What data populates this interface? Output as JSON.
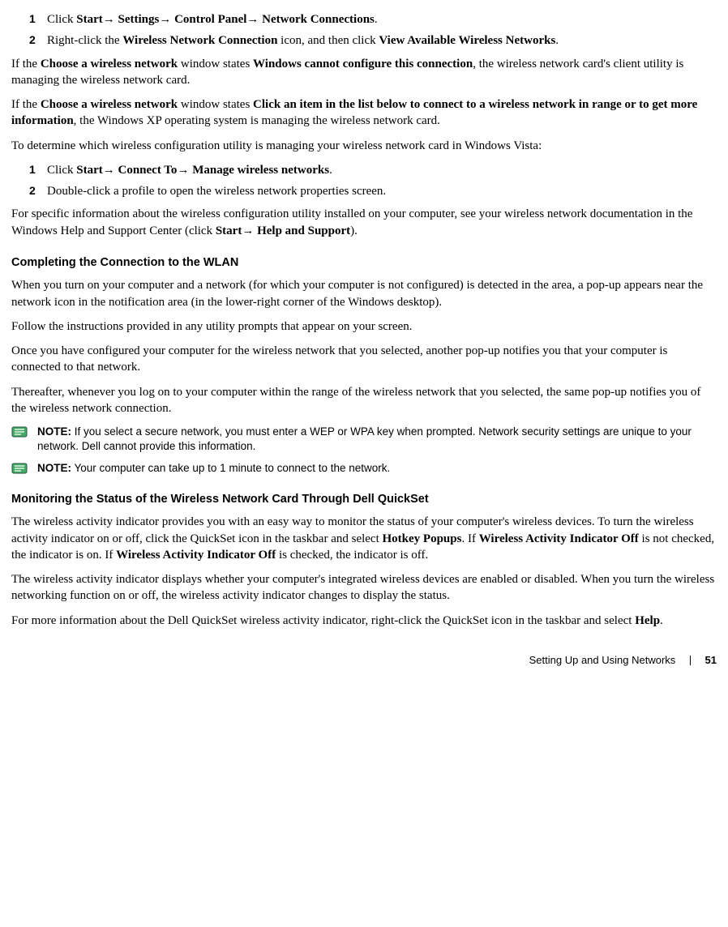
{
  "listA": {
    "step1": {
      "num": "1",
      "pre": "Click ",
      "b1": "Start",
      "arr1": "→ ",
      "b2": "Settings",
      "arr2": "→ ",
      "b3": "Control Panel",
      "arr3": "→ ",
      "b4": "Network Connections",
      "post": "."
    },
    "step2": {
      "num": "2",
      "pre": "Right-click the ",
      "b1": "Wireless Network Connection",
      "mid": " icon, and then click ",
      "b2": "View Available Wireless Networks",
      "post": "."
    }
  },
  "paraA": {
    "pre": "If the ",
    "b1": "Choose a wireless network",
    "mid1": " window states ",
    "b2": "Windows cannot configure this connection",
    "post": ", the wireless network card's client utility is managing the wireless network card."
  },
  "paraB": {
    "pre": "If the ",
    "b1": "Choose a wireless network",
    "mid1": " window states ",
    "b2": "Click an item in the list below to connect to a wireless network in range or to get more information",
    "post": ", the Windows XP operating system is managing the wireless network card."
  },
  "paraC": "To determine which wireless configuration utility is managing your wireless network card in Windows Vista:",
  "listB": {
    "step1": {
      "num": "1",
      "pre": "Click ",
      "b1": "Start",
      "arr1": "→ ",
      "b2": "Connect To",
      "arr2": "→ ",
      "b3": "Manage wireless networks",
      "post": "."
    },
    "step2": {
      "num": "2",
      "text": "Double-click a profile to open the wireless network properties screen."
    }
  },
  "paraD": {
    "pre": "For specific information about the wireless configuration utility installed on your computer, see your wireless network documentation in the Windows Help and Support Center (click ",
    "b1": "Start",
    "arr1": "→ ",
    "b2": "Help and Support",
    "post": ")."
  },
  "heading1": "Completing the Connection to the WLAN",
  "paraE": "When you turn on your computer and a network (for which your computer is not configured) is detected in the area, a pop-up appears near the network icon in the notification area (in the lower-right corner of the Windows desktop).",
  "paraF": "Follow the instructions provided in any utility prompts that appear on your screen.",
  "paraG": "Once you have configured your computer for the wireless network that you selected, another pop-up notifies you that your computer is connected to that network.",
  "paraH": "Thereafter, whenever you log on to your computer within the range of the wireless network that you selected, the same pop-up notifies you of the wireless network connection.",
  "note1": {
    "label": "NOTE:",
    "text": " If you select a secure network, you must enter a WEP or WPA key when prompted. Network security settings are unique to your network. Dell cannot provide this information."
  },
  "note2": {
    "label": "NOTE:",
    "text": " Your computer can take up to 1 minute to connect to the network."
  },
  "heading2": "Monitoring the Status of the Wireless Network Card Through Dell QuickSet",
  "paraI": {
    "pre": "The wireless activity indicator provides you with an easy way to monitor the status of your computer's wireless devices. To turn the wireless activity indicator on or off, click the QuickSet icon in the taskbar and select ",
    "b1": "Hotkey Popups",
    "mid1": ". If ",
    "b2": "Wireless Activity Indicator Off",
    "mid2": " is not checked, the indicator is on. If ",
    "b3": "Wireless Activity Indicator Off",
    "post": " is checked, the indicator is off."
  },
  "paraJ": "The wireless activity indicator displays whether your computer's integrated wireless devices are enabled or disabled. When you turn the wireless networking function on or off, the wireless activity indicator changes to display the status.",
  "paraK": {
    "pre": "For more information about the Dell QuickSet wireless activity indicator, right-click the QuickSet icon in the taskbar and select ",
    "b1": "Help",
    "post": "."
  },
  "footer": {
    "section": "Setting Up and Using Networks",
    "page": "51"
  }
}
